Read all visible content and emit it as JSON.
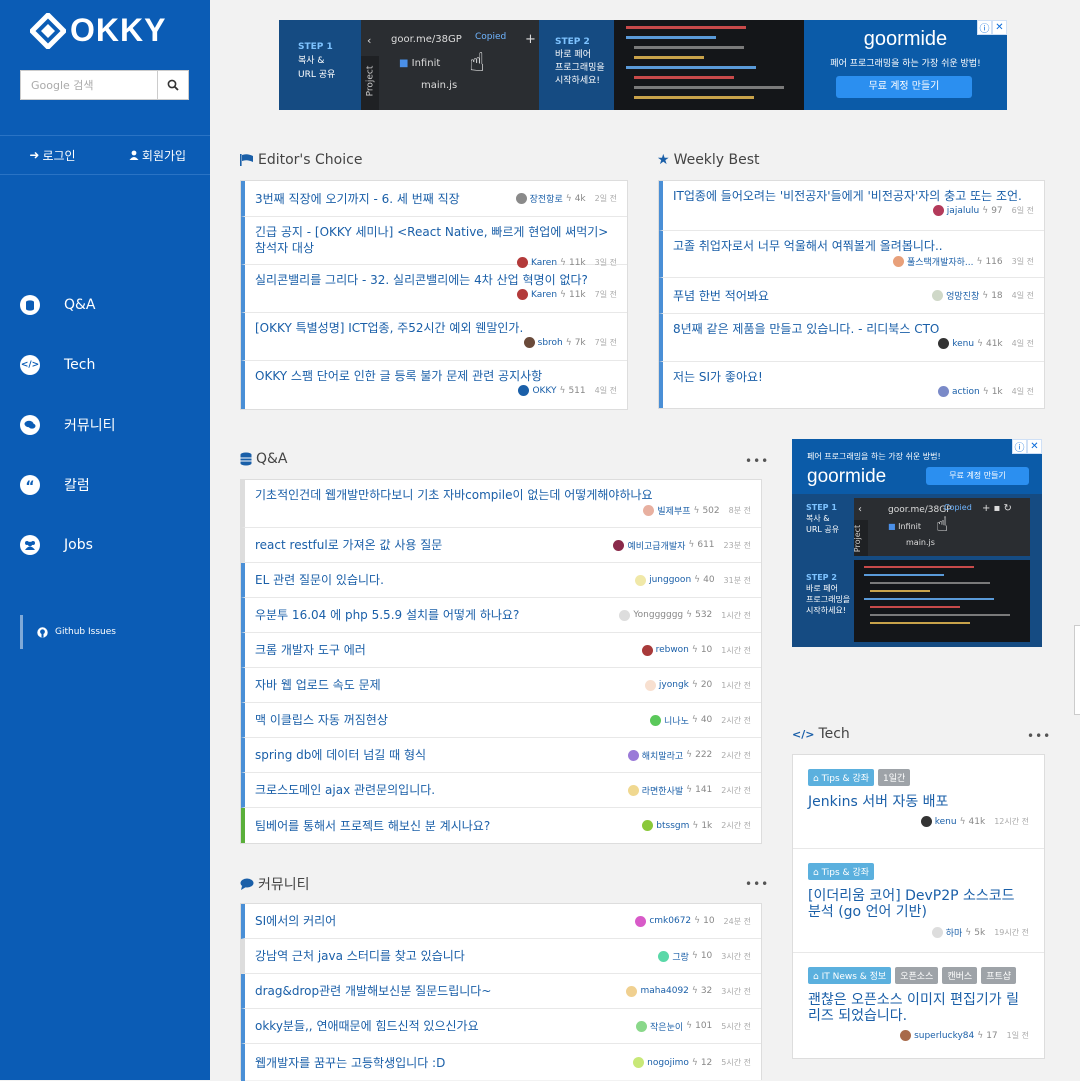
{
  "logo": {
    "text": "OKKY"
  },
  "search": {
    "placeholder": "Google 검색"
  },
  "auth": {
    "login": "로그인",
    "signup": "회원가입"
  },
  "nav": [
    {
      "label": "Q&A",
      "icon": "database-icon"
    },
    {
      "label": "Tech",
      "icon": "code-icon"
    },
    {
      "label": "커뮤니티",
      "icon": "comments-icon"
    },
    {
      "label": "칼럼",
      "icon": "quote-icon"
    },
    {
      "label": "Jobs",
      "icon": "group-icon"
    }
  ],
  "github": {
    "label": "Github Issues"
  },
  "ad_top": {
    "step1_label": "STEP 1",
    "step1_text1": "복사 &",
    "step1_text2": "URL 공유",
    "url": "goor.me/38GP",
    "copied": "Copied",
    "tree_item": "Infinit",
    "file": "main.js",
    "sidebar_label": "Project",
    "step2_label": "STEP 2",
    "step2_text1": "바로 페어",
    "step2_text2": "프로그래밍을",
    "step2_text3": "시작하세요!",
    "brand": "goormide",
    "tagline": "페어 프로그래밍을 하는 가장 쉬운 방법!",
    "cta": "무료 계정 만들기"
  },
  "ad_side": {
    "tagline": "페어 프로그래밍을 하는 가장 쉬운 방법!",
    "brand": "goormide",
    "cta": "무료 계정 만들기",
    "step1_label": "STEP 1",
    "step1_text1": "복사 &",
    "step1_text2": "URL 공유",
    "url": "goor.me/38GP",
    "copied": "Copied",
    "tree_item": "Infinit",
    "file": "main.js",
    "sidebar_label": "Project",
    "step2_label": "STEP 2",
    "step2_text1": "바로 페어",
    "step2_text2": "프로그래밍을",
    "step2_text3": "시작하세요!"
  },
  "editors_choice": {
    "title": "Editor's Choice",
    "items": [
      {
        "title": "3번째 직장에 오기까지 - 6. 세 번째 직장",
        "author": "장전항로",
        "score": "4k",
        "time": "2일 전"
      },
      {
        "title": "긴급 공지 - [OKKY 세미나] <React Native, 빠르게 현업에 써먹기> 참석자 대상",
        "author": "Karen",
        "score": "11k",
        "time": "3일 전"
      },
      {
        "title": "실리콘밸리를 그리다 - 32. 실리콘밸리에는 4차 산업 혁명이 없다?",
        "author": "Karen",
        "score": "11k",
        "time": "7일 전"
      },
      {
        "title": "[OKKY 특별성명] ICT업종, 주52시간 예외 웬말인가.",
        "author": "sbroh",
        "score": "7k",
        "time": "7일 전"
      },
      {
        "title": "OKKY 스팸 단어로 인한 글 등록 불가 문제 관련 공지사항",
        "author": "OKKY",
        "score": "511",
        "time": "4일 전"
      }
    ]
  },
  "weekly_best": {
    "title": "Weekly Best",
    "items": [
      {
        "title": "IT업종에 들어오려는 '비전공자'들에게 '비전공자'자의 충고 또는 조언.",
        "author": "jajalulu",
        "score": "97",
        "time": "6일 전"
      },
      {
        "title": "고졸 취업자로서 너무 억울해서 여쭤볼게 올려봅니다..",
        "author": "풀스택개발자하...",
        "score": "116",
        "time": "3일 전"
      },
      {
        "title": "푸념 한번 적어봐요",
        "author": "엉망진창",
        "score": "18",
        "time": "4일 전"
      },
      {
        "title": "8년째 같은 제품을 만들고 있습니다. - 리디북스 CTO",
        "author": "kenu",
        "score": "41k",
        "time": "4일 전"
      },
      {
        "title": "저는 SI가 좋아요!",
        "author": "action",
        "score": "1k",
        "time": "4일 전"
      }
    ]
  },
  "qna": {
    "title": "Q&A",
    "more": "•••",
    "items": [
      {
        "title": "기초적인건데 웹개발만하다보니 기초 자바compile이 없는데 어떻게해야하나요",
        "author": "빌제부프",
        "score": "502",
        "time": "8분 전"
      },
      {
        "title": "react restful로 가져온 값 사용 질문",
        "author": "예비고급개발자",
        "score": "611",
        "time": "23분 전"
      },
      {
        "title": "EL 관련 질문이 있습니다.",
        "author": "junggoon",
        "score": "40",
        "time": "31분 전"
      },
      {
        "title": "우분투 16.04 에 php 5.5.9 설치를 어떻게 하나요?",
        "author": "Yongggggg",
        "score": "532",
        "time": "1시간 전"
      },
      {
        "title": "크롬 개발자 도구 에러",
        "author": "rebwon",
        "score": "10",
        "time": "1시간 전"
      },
      {
        "title": "자바 웹 업로드 속도 문제",
        "author": "jyongk",
        "score": "20",
        "time": "1시간 전"
      },
      {
        "title": "맥 이클립스 자동 꺼짐현상",
        "author": "니나노",
        "score": "40",
        "time": "2시간 전"
      },
      {
        "title": "spring db에 데이터 넘길 때 형식",
        "author": "해치말라고",
        "score": "222",
        "time": "2시간 전"
      },
      {
        "title": "크로스도메인 ajax 관련문의입니다.",
        "author": "라면한사발",
        "score": "141",
        "time": "2시간 전"
      },
      {
        "title": "팀베어를 통해서 프로젝트 해보신 분 계시나요?",
        "author": "btssgm",
        "score": "1k",
        "time": "2시간 전"
      }
    ]
  },
  "community": {
    "title": "커뮤니티",
    "more": "•••",
    "items": [
      {
        "title": "SI에서의 커리어",
        "author": "cmk0672",
        "score": "10",
        "time": "24분 전"
      },
      {
        "title": "강남역 근처 java 스터디를 찾고 있습니다",
        "author": "그랑",
        "score": "10",
        "time": "3시간 전"
      },
      {
        "title": "drag&drop관련 개발해보신분 질문드립니다~",
        "author": "maha4092",
        "score": "32",
        "time": "3시간 전"
      },
      {
        "title": "okky분들,, 연애때문에 힘드신적 있으신가요",
        "author": "작은눈이",
        "score": "101",
        "time": "5시간 전"
      },
      {
        "title": "웹개발자를 꿈꾸는 고등학생입니다 :D",
        "author": "nogojimo",
        "score": "12",
        "time": "5시간 전"
      }
    ]
  },
  "tech": {
    "title": "Tech",
    "more": "•••",
    "items": [
      {
        "tags": [
          "Tips & 강좌",
          "1일간"
        ],
        "title": "Jenkins 서버 자동 배포",
        "author": "kenu",
        "score": "41k",
        "time": "12시간 전"
      },
      {
        "tags": [
          "Tips & 강좌"
        ],
        "title": "[이더리움 코어] DevP2P 소스코드 분석 (go 언어 기반)",
        "author": "하마",
        "score": "5k",
        "time": "19시간 전"
      },
      {
        "tags": [
          "IT News & 정보",
          "오픈소스",
          "캔버스",
          "프트샵"
        ],
        "title": "괜찮은 오픈소스 이미지 편집기가 릴리즈 되었습니다.",
        "author": "superlucky84",
        "score": "17",
        "time": "1일 전"
      }
    ]
  },
  "colors": {
    "sidebar": "#0b5cb5",
    "link": "#1a5fa8",
    "accent_border": "#4a8fd6",
    "tag_blue": "#5bb0de"
  }
}
